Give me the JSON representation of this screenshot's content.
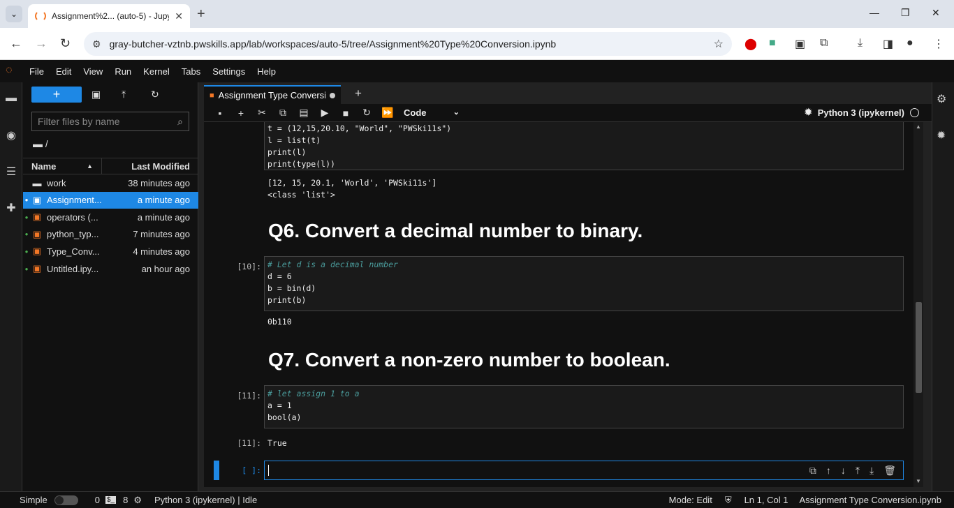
{
  "browser": {
    "tab_title": "Assignment%2... (auto-5) - Jupy",
    "url": "gray-butcher-vztnb.pwskills.app/lab/workspaces/auto-5/tree/Assignment%20Type%20Conversion.ipynb"
  },
  "menu": [
    "File",
    "Edit",
    "View",
    "Run",
    "Kernel",
    "Tabs",
    "Settings",
    "Help"
  ],
  "filebrowser": {
    "filter_placeholder": "Filter files by name",
    "path": "/",
    "col_name": "Name",
    "col_modified": "Last Modified",
    "files": [
      {
        "name": "work",
        "modified": "38 minutes ago",
        "type": "folder",
        "running": false,
        "selected": false
      },
      {
        "name": "Assignment...",
        "modified": "a minute ago",
        "type": "notebook",
        "running": true,
        "selected": true
      },
      {
        "name": "operators (...",
        "modified": "a minute ago",
        "type": "notebook",
        "running": true,
        "selected": false
      },
      {
        "name": "python_typ...",
        "modified": "7 minutes ago",
        "type": "notebook",
        "running": true,
        "selected": false
      },
      {
        "name": "Type_Conv...",
        "modified": "4 minutes ago",
        "type": "notebook",
        "running": true,
        "selected": false
      },
      {
        "name": "Untitled.ipy...",
        "modified": "an hour ago",
        "type": "notebook",
        "running": true,
        "selected": false
      }
    ]
  },
  "notebook": {
    "tab_title": "Assignment Type Conversion",
    "cell_type": "Code",
    "kernel": "Python 3 (ipykernel)",
    "cells": {
      "c9_line1": "t = (12,15,20.10, \"World\", \"PWSki11s\")",
      "c9_line2": "l = list(t)",
      "c9_line3": "print(l)",
      "c9_line4": "print(type(l))",
      "c9_out1": "[12, 15, 20.1, 'World', 'PWSki11s']",
      "c9_out2": "<class 'list'>",
      "q6": "Q6. Convert a decimal number to binary.",
      "c10_prompt": "[10]:",
      "c10_line1": "# Let d is a decimal number",
      "c10_line2": "d = 6",
      "c10_line3": "b = bin(d)",
      "c10_line4": "print(b)",
      "c10_out": "0b110",
      "q7": "Q7. Convert a non-zero number to boolean.",
      "c11_prompt": "[11]:",
      "c11_line1": "# let assign 1 to a",
      "c11_line2": "a = 1",
      "c11_line3": "bool(a)",
      "c11_out_prompt": "[11]:",
      "c11_out": "True",
      "empty_prompt": "[ ]:"
    }
  },
  "status": {
    "mode_label": "Simple",
    "terminals": "0",
    "kernels": "8",
    "kernel_status": "Python 3 (ipykernel) | Idle",
    "mode": "Mode: Edit",
    "position": "Ln 1, Col 1",
    "filename": "Assignment Type Conversion.ipynb"
  }
}
